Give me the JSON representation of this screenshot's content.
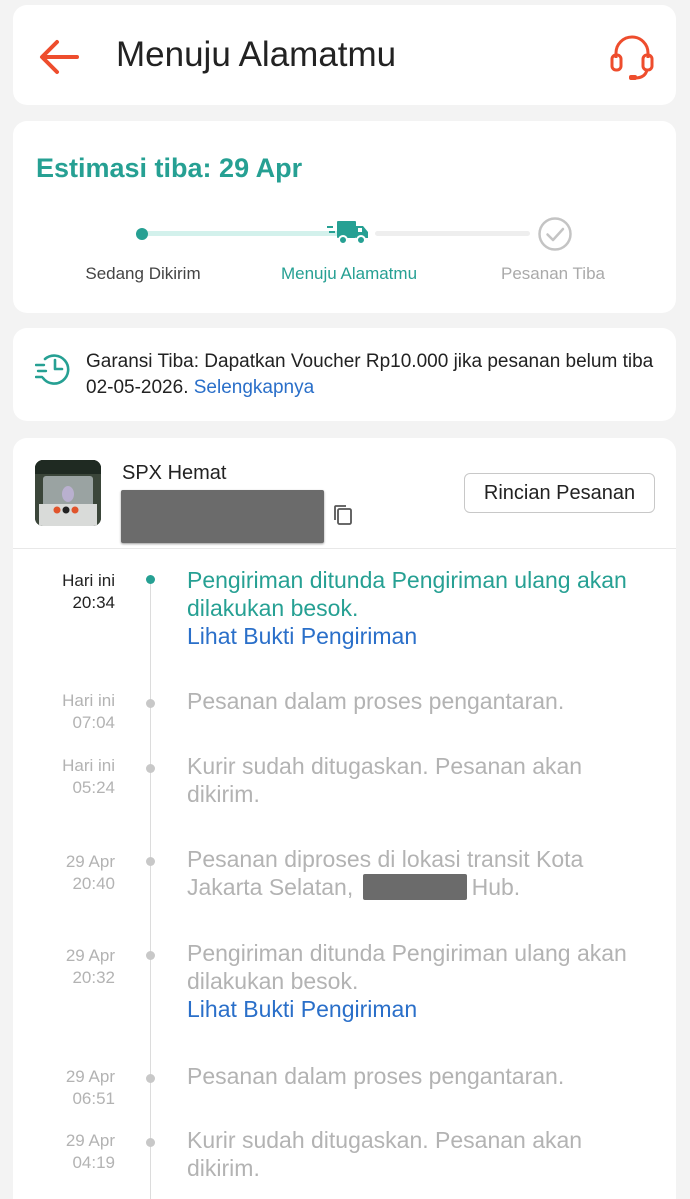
{
  "header": {
    "title": "Menuju Alamatmu"
  },
  "status": {
    "eta": "Estimasi tiba: 29 Apr",
    "steps": [
      {
        "label": "Sedang Dikirim",
        "state": "done"
      },
      {
        "label": "Menuju Alamatmu",
        "state": "current"
      },
      {
        "label": "Pesanan Tiba",
        "state": "pending"
      }
    ]
  },
  "guarantee": {
    "text": "Garansi Tiba: Dapatkan Voucher Rp10.000 jika pesanan belum tiba 02-05-2026.",
    "link": "Selengkapnya"
  },
  "shipment": {
    "courier": "SPX Hemat",
    "detail_button": "Rincian Pesanan"
  },
  "timeline": [
    {
      "date": "Hari ini",
      "time": "20:34",
      "text": "Pengiriman ditunda  Pengiriman ulang akan dilakukan besok.",
      "link": "Lihat Bukti Pengiriman",
      "active": true
    },
    {
      "date": "Hari ini",
      "time": "07:04",
      "text": "Pesanan dalam proses pengantaran."
    },
    {
      "date": "Hari ini",
      "time": "05:24",
      "text": "Kurir sudah ditugaskan. Pesanan akan dikirim."
    },
    {
      "date": "29 Apr",
      "time": "20:40",
      "text_before": "Pesanan diproses di lokasi transit Kota Jakarta Selatan, ",
      "text_after": "Hub."
    },
    {
      "date": "29 Apr",
      "time": "20:32",
      "text": "Pengiriman ditunda  Pengiriman ulang akan dilakukan besok.",
      "link": "Lihat Bukti Pengiriman"
    },
    {
      "date": "29 Apr",
      "time": "06:51",
      "text": "Pesanan dalam proses pengantaran."
    },
    {
      "date": "29 Apr",
      "time": "04:19",
      "text": "Kurir sudah ditugaskan. Pesanan akan dikirim."
    }
  ],
  "colors": {
    "accent": "#26a093",
    "brand": "#ee4d2d",
    "link": "#2a6fc9"
  },
  "icons": {
    "back": "back-arrow-icon",
    "support": "headset-icon",
    "truck": "truck-icon",
    "check": "check-circle-icon",
    "guarantee": "fast-clock-icon",
    "copy": "copy-icon"
  }
}
